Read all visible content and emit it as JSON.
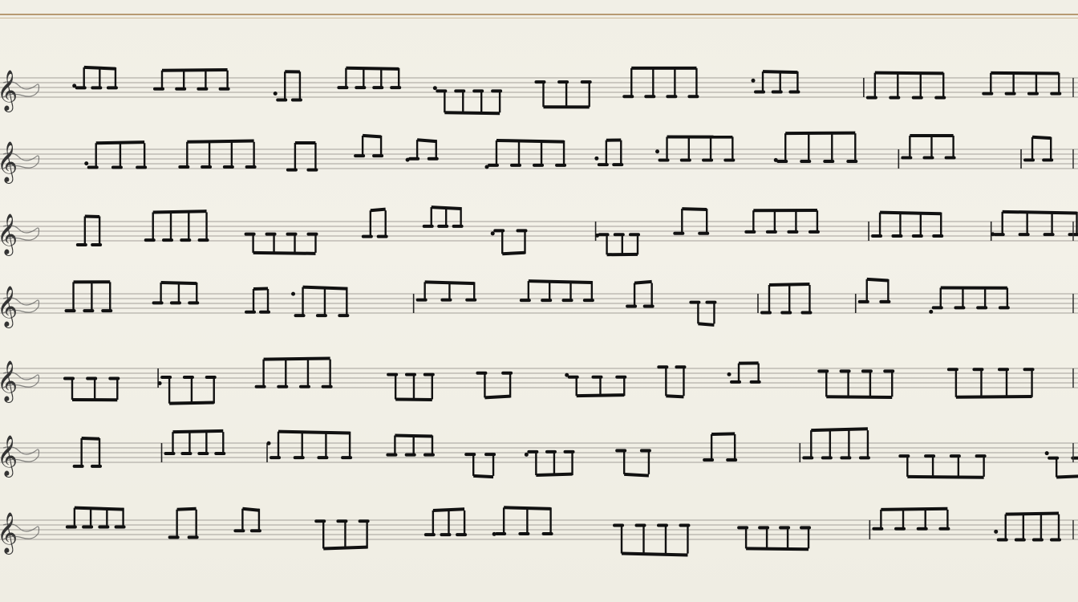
{
  "image": {
    "kind": "sheet-music-photo",
    "paper_color": "#f1efe6",
    "ink_color": "#111111",
    "staff_line_color": "#a4a09a",
    "border_color": "#b79a72",
    "system_count": 7,
    "icons": [
      "treble-clef-icon",
      "note-group-icon",
      "barline-icon",
      "beam-icon"
    ]
  }
}
